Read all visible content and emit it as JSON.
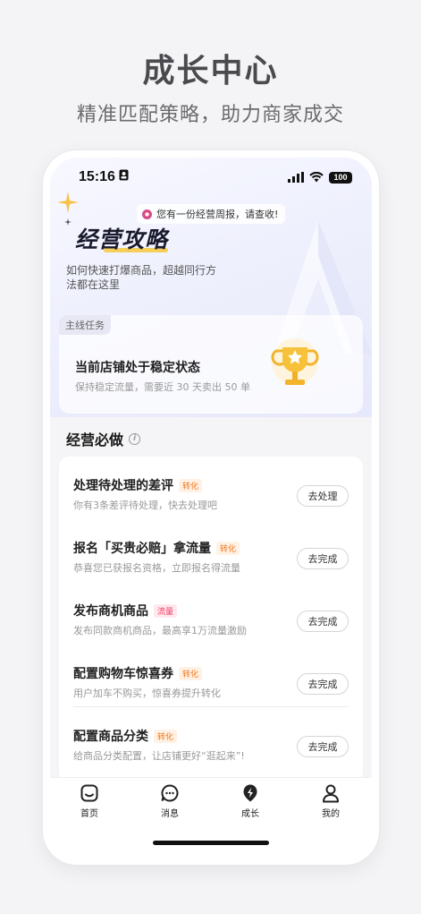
{
  "promo": {
    "headline": "成长中心",
    "subline": "精准匹配策略，助力商家成交"
  },
  "status_bar": {
    "time": "15:16",
    "battery": "100"
  },
  "notice": {
    "text": "您有一份经营周报，请查收!"
  },
  "hero": {
    "title": "经营攻略",
    "description": "如何快速打爆商品，超越同行方法都在这里"
  },
  "task_card": {
    "tag": "主线任务",
    "title": "当前店铺处于稳定状态",
    "subtitle": "保持稳定流量，需要近 30 天卖出 50 单"
  },
  "section": {
    "title": "经营必做"
  },
  "tasks": [
    {
      "title": "处理待处理的差评",
      "tag": "转化",
      "tag_type": "convert",
      "subtitle": "你有3条差评待处理，快去处理吧",
      "button": "去处理"
    },
    {
      "title": "报名「买贵必赔」拿流量",
      "tag": "转化",
      "tag_type": "convert",
      "subtitle": "恭喜您已获报名资格，立即报名得流量",
      "button": "去完成"
    },
    {
      "title": "发布商机商品",
      "tag": "流量",
      "tag_type": "traffic",
      "subtitle": "发布同款商机商品，最高享1万流量激励",
      "button": "去完成"
    },
    {
      "title": "配置购物车惊喜券",
      "tag": "转化",
      "tag_type": "convert",
      "subtitle": "用户加车不购买，惊喜券提升转化",
      "button": "去完成"
    },
    {
      "title": "配置商品分类",
      "tag": "转化",
      "tag_type": "convert",
      "subtitle": "给商品分类配置，让店铺更好“逛起来”!",
      "button": "去完成"
    }
  ],
  "tab_bar": {
    "items": [
      {
        "label": "首页",
        "icon": "home-icon"
      },
      {
        "label": "消息",
        "icon": "message-icon"
      },
      {
        "label": "成长",
        "icon": "lightning-icon",
        "active": true
      },
      {
        "label": "我的",
        "icon": "profile-icon"
      }
    ]
  },
  "colors": {
    "convert_tag": "#f0781e",
    "traffic_tag": "#ef3b63",
    "hero_accent": "#f6c83e"
  }
}
